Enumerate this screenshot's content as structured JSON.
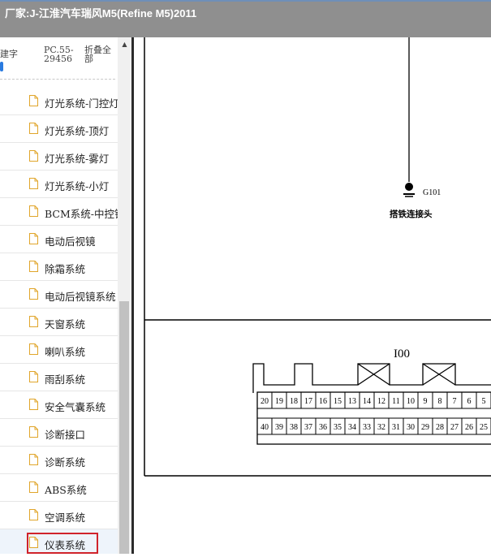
{
  "window": {
    "title": "厂家:J-江淮汽车瑞风M5(Refine M5)2011"
  },
  "toolbar": {
    "keyword_label": "建字",
    "pc_label": "PC.55-29456",
    "fold_all_label": "折叠全部"
  },
  "list": {
    "items": [
      {
        "label": "灯光系统-门控灯"
      },
      {
        "label": "灯光系统-顶灯"
      },
      {
        "label": "灯光系统-雾灯"
      },
      {
        "label": "灯光系统-小灯"
      },
      {
        "label": "BCM系统-中控锁"
      },
      {
        "label": "电动后视镜"
      },
      {
        "label": "除霜系统"
      },
      {
        "label": "电动后视镜系统"
      },
      {
        "label": "天窗系统"
      },
      {
        "label": "喇叭系统"
      },
      {
        "label": "雨刮系统"
      },
      {
        "label": "安全气囊系统"
      },
      {
        "label": "诊断接口"
      },
      {
        "label": "诊断系统"
      },
      {
        "label": "ABS系统"
      },
      {
        "label": "空调系统"
      },
      {
        "label": "仪表系统"
      }
    ],
    "selected": "仪表系统"
  },
  "diagram": {
    "ground_id": "G101",
    "ground_label": "搭铁连接头",
    "connector_id": "I00",
    "pins_top": [
      "20",
      "19",
      "18",
      "17",
      "16",
      "15",
      "13",
      "14",
      "12",
      "11",
      "10",
      "9",
      "8",
      "7",
      "6",
      "5"
    ],
    "pins_bottom": [
      "40",
      "39",
      "38",
      "37",
      "36",
      "35",
      "34",
      "33",
      "32",
      "31",
      "30",
      "29",
      "28",
      "27",
      "26",
      "25"
    ]
  }
}
